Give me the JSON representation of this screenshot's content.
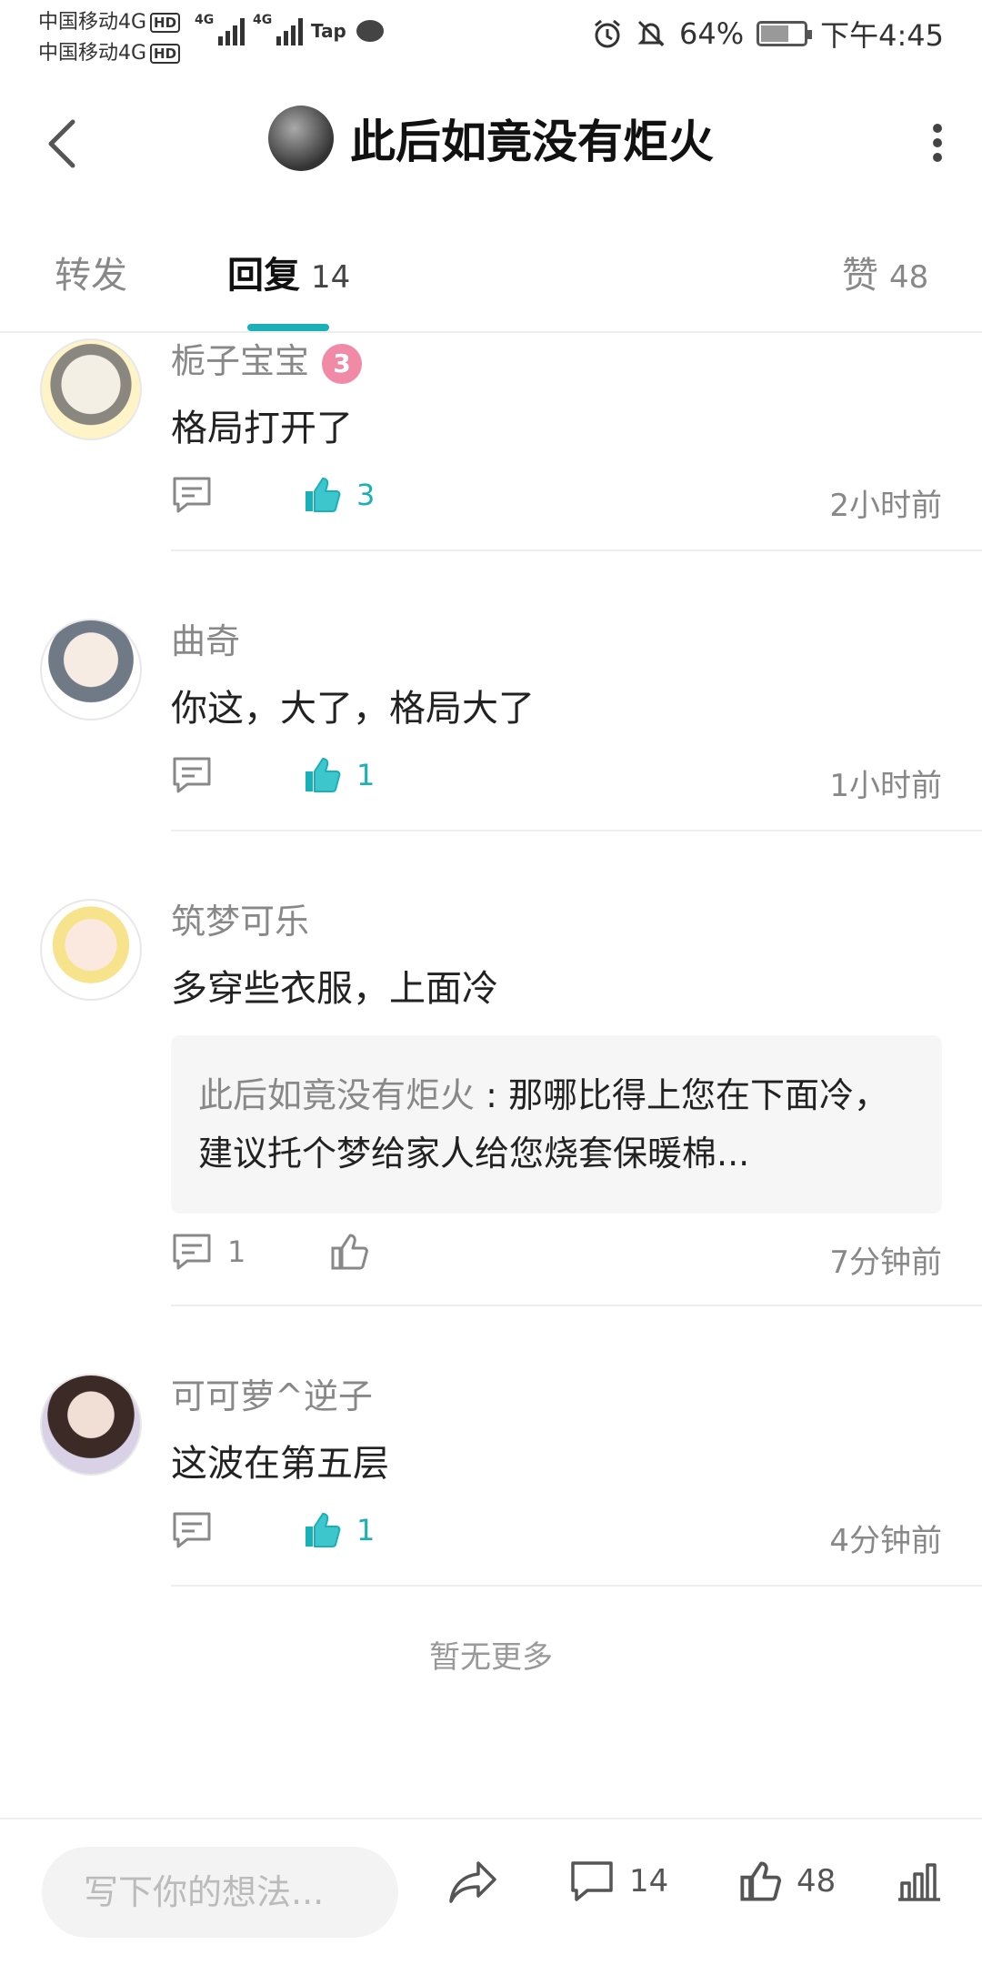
{
  "status_bar": {
    "carrier1": "中国移动4G",
    "carrier2": "中国移动4G",
    "hd": "HD",
    "net1": "4G",
    "net2": "4G",
    "tap": "Tap",
    "battery": "64%",
    "battery_level": 0.64,
    "time": "下午4:45"
  },
  "header": {
    "title": "此后如竟没有炬火"
  },
  "tabs": [
    {
      "label": "转发",
      "count": ""
    },
    {
      "label": "回复",
      "count": "14"
    },
    {
      "label": "赞",
      "count": "48"
    }
  ],
  "comments": [
    {
      "name": "栀子宝宝",
      "badge": "3",
      "text": "格局打开了",
      "reply_count": "",
      "likes": "3",
      "time": "2小时前"
    },
    {
      "name": "曲奇",
      "text": "你这，大了，格局大了",
      "reply_count": "",
      "likes": "1",
      "time": "1小时前"
    },
    {
      "name": "筑梦可乐",
      "text": "多穿些衣服，上面冷",
      "quote_name": "此后如竟没有炬火",
      "quote_text": " : 那哪比得上您在下面冷，建议托个梦给家人给您烧套保暖棉...",
      "reply_count": "1",
      "likes": "",
      "time": "7分钟前"
    },
    {
      "name": "可可萝^逆子",
      "text": "这波在第五层",
      "reply_count": "",
      "likes": "1",
      "time": "4分钟前"
    }
  ],
  "no_more": "暂无更多",
  "bottom_bar": {
    "input_placeholder": "写下你的想法...",
    "comment_count": "14",
    "like_count": "48"
  },
  "colors": {
    "accent": "#1ab0b8",
    "muted": "#888888",
    "text": "#222222"
  }
}
